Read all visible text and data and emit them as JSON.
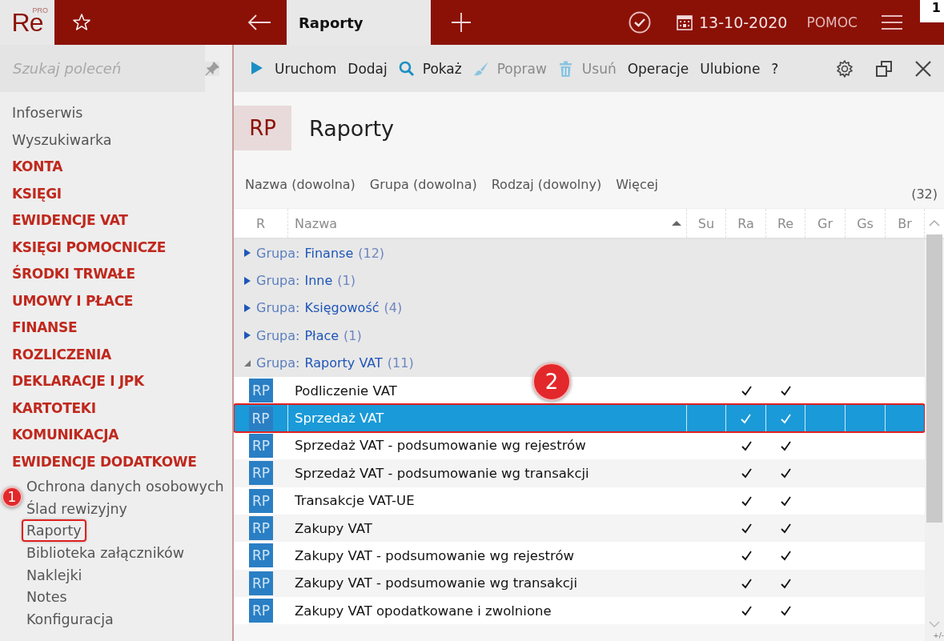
{
  "topbar": {
    "logo": "Re",
    "logo_sup": "PRO",
    "tab": "Raporty",
    "date": "13-10-2020",
    "help": "POMOC",
    "badge": "1"
  },
  "sidebar": {
    "search": {
      "placeholder": "Szukaj poleceń"
    },
    "items": [
      {
        "label": "Infoserwis",
        "kind": "link"
      },
      {
        "label": "Wyszukiwarka",
        "kind": "link"
      },
      {
        "label": "KONTA",
        "kind": "section"
      },
      {
        "label": "KSIĘGI",
        "kind": "section"
      },
      {
        "label": "EWIDENCJE VAT",
        "kind": "section"
      },
      {
        "label": "KSIĘGI POMOCNICZE",
        "kind": "section"
      },
      {
        "label": "ŚRODKI TRWAŁE",
        "kind": "section"
      },
      {
        "label": "UMOWY I PŁACE",
        "kind": "section"
      },
      {
        "label": "FINANSE",
        "kind": "section"
      },
      {
        "label": "ROZLICZENIA",
        "kind": "section"
      },
      {
        "label": "DEKLARACJE I JPK",
        "kind": "section"
      },
      {
        "label": "KARTOTEKI",
        "kind": "section"
      },
      {
        "label": "KOMUNIKACJA",
        "kind": "section"
      },
      {
        "label": "EWIDENCJE DODATKOWE",
        "kind": "section",
        "children": [
          {
            "label": "Ochrona danych osobowych",
            "selected": false
          },
          {
            "label": "Ślad rewizyjny",
            "selected": false
          },
          {
            "label": "Raporty",
            "selected": true
          },
          {
            "label": "Biblioteka załączników",
            "selected": false
          },
          {
            "label": "Naklejki",
            "selected": false
          },
          {
            "label": "Notes",
            "selected": false
          },
          {
            "label": "Konfiguracja",
            "selected": false
          }
        ]
      }
    ]
  },
  "toolbar": [
    {
      "label": "Uruchom",
      "kind": "run",
      "disabled": false
    },
    {
      "label": "Dodaj",
      "kind": "text",
      "disabled": false
    },
    {
      "label": "Pokaż",
      "kind": "show",
      "disabled": false
    },
    {
      "label": "Popraw",
      "kind": "edit",
      "disabled": true
    },
    {
      "label": "Usuń",
      "kind": "delete",
      "disabled": true
    },
    {
      "label": "Operacje",
      "kind": "text",
      "disabled": false
    },
    {
      "label": "Ulubione",
      "kind": "text",
      "disabled": false
    },
    {
      "label": "?",
      "kind": "text",
      "disabled": false
    }
  ],
  "header": {
    "code": "RP",
    "title": "Raporty"
  },
  "filters": [
    "Nazwa (dowolna)",
    "Grupa (dowolna)",
    "Rodzaj (dowolny)",
    "Więcej"
  ],
  "count": "(32)",
  "table": {
    "columns": [
      "R",
      "Nazwa",
      "Su",
      "Ra",
      "Re",
      "Gr",
      "Gs",
      "Br"
    ],
    "groups": [
      {
        "prefix": "Grupa:",
        "name": "Finanse",
        "count": "(12)",
        "expanded": false
      },
      {
        "prefix": "Grupa:",
        "name": "Inne",
        "count": "(1)",
        "expanded": false
      },
      {
        "prefix": "Grupa:",
        "name": "Księgowość",
        "count": "(4)",
        "expanded": false
      },
      {
        "prefix": "Grupa:",
        "name": "Płace",
        "count": "(1)",
        "expanded": false
      },
      {
        "prefix": "Grupa:",
        "name": "Raporty VAT",
        "count": "(11)",
        "expanded": true
      }
    ],
    "rows": [
      {
        "icon": "RP",
        "name": "Podliczenie VAT",
        "su": false,
        "ra": true,
        "re": true,
        "gr": false,
        "gs": false,
        "br": false,
        "selected": false
      },
      {
        "icon": "RP",
        "name": "Sprzedaż VAT",
        "su": false,
        "ra": true,
        "re": true,
        "gr": false,
        "gs": false,
        "br": false,
        "selected": true
      },
      {
        "icon": "RP",
        "name": "Sprzedaż VAT - podsumowanie wg rejestrów",
        "su": false,
        "ra": true,
        "re": true,
        "gr": false,
        "gs": false,
        "br": false,
        "selected": false
      },
      {
        "icon": "RP",
        "name": "Sprzedaż VAT - podsumowanie wg transakcji",
        "su": false,
        "ra": true,
        "re": true,
        "gr": false,
        "gs": false,
        "br": false,
        "selected": false
      },
      {
        "icon": "RP",
        "name": "Transakcje VAT-UE",
        "su": false,
        "ra": true,
        "re": true,
        "gr": false,
        "gs": false,
        "br": false,
        "selected": false
      },
      {
        "icon": "RP",
        "name": "Zakupy VAT",
        "su": false,
        "ra": true,
        "re": true,
        "gr": false,
        "gs": false,
        "br": false,
        "selected": false
      },
      {
        "icon": "RP",
        "name": "Zakupy VAT - podsumowanie wg rejestrów",
        "su": false,
        "ra": true,
        "re": true,
        "gr": false,
        "gs": false,
        "br": false,
        "selected": false
      },
      {
        "icon": "RP",
        "name": "Zakupy VAT - podsumowanie wg transakcji",
        "su": false,
        "ra": true,
        "re": true,
        "gr": false,
        "gs": false,
        "br": false,
        "selected": false
      },
      {
        "icon": "RP",
        "name": "Zakupy VAT opodatkowane i zwolnione",
        "su": false,
        "ra": true,
        "re": true,
        "gr": false,
        "gs": false,
        "br": false,
        "selected": false
      }
    ],
    "corner": "+/-"
  },
  "annotations": [
    {
      "label": "1"
    },
    {
      "label": "2"
    }
  ]
}
